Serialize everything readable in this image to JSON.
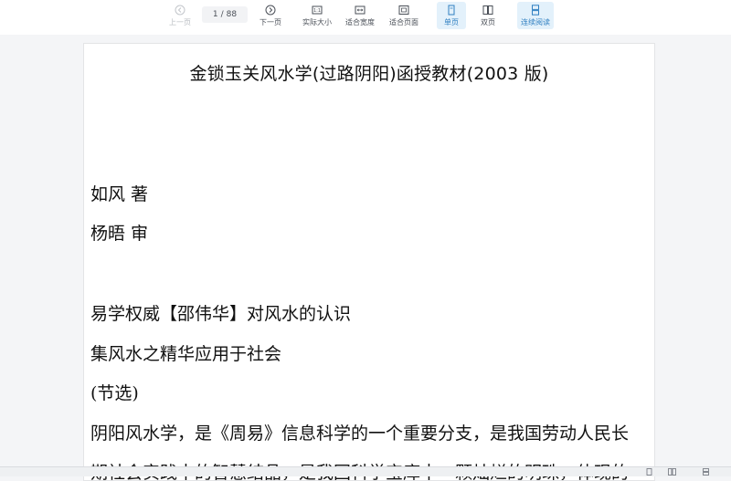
{
  "toolbar": {
    "prev_label": "上一页",
    "page_current": "1",
    "page_sep": "/",
    "page_total": "88",
    "next_label": "下一页",
    "actual_size_label": "实际大小",
    "fit_width_label": "适合宽度",
    "fit_page_label": "适合页面",
    "single_page_label": "单页",
    "double_page_label": "双页",
    "continuous_label": "连续阅读"
  },
  "document": {
    "title": "金锁玉关风水学(过路阴阳)函授教材(2003 版)",
    "lines": [
      "如风  著",
      "杨晤  审",
      "易学权威【邵伟华】对风水的认识",
      "集风水之精华应用于社会",
      "(节选)",
      "阴阳风水学，是《周易》信息科学的一个重要分支，是我国劳动人民长",
      "期社会实践中的智慧结晶，是我国科学宝库中一颗灿烂的明珠，体现的"
    ]
  },
  "colors": {
    "accent": "#2f7fc1",
    "active_bg": "#e3f1fb",
    "toolbar_bg": "#ffffff",
    "canvas_bg": "#f4f5f7"
  }
}
